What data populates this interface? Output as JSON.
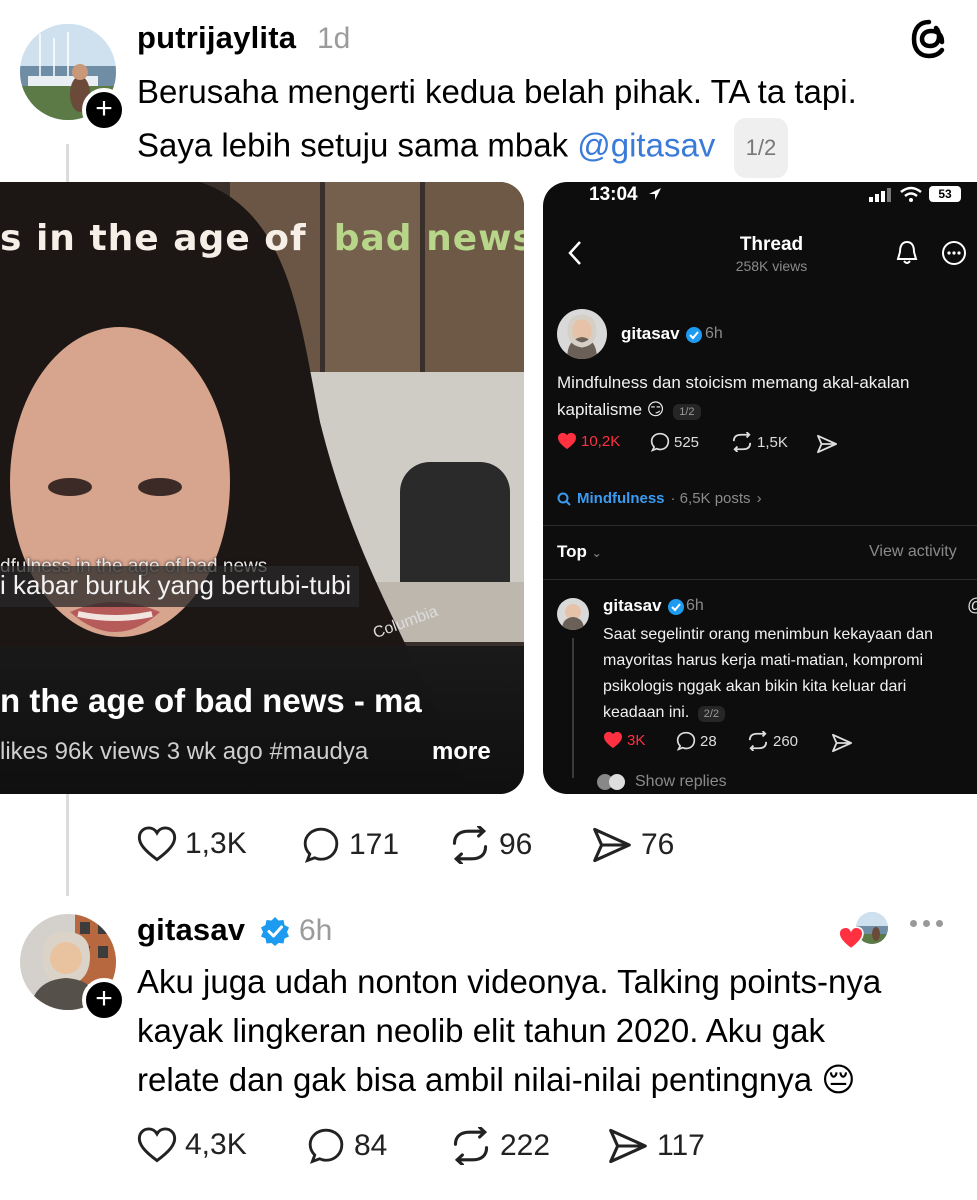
{
  "post1": {
    "username": "putrijaylita",
    "time": "1d",
    "text_line1": "Berusaha mengerti kedua belah pihak. TA ta tapi.",
    "text_line2_prefix": "Saya lebih setuju sama mbak ",
    "mention": "@gitasav",
    "page_pill": "1/2",
    "likes": "1,3K",
    "replies": "171",
    "reposts": "96",
    "shares": "76"
  },
  "video": {
    "top_title_a": "s  in the age of",
    "top_title_b": "bad news",
    "subtitle_small": "dfulness in the age of bad news",
    "subtitle_big": "i kabar buruk yang bertubi-tubi",
    "shirt_brand": "Columbia",
    "bottom_title": "n the age of bad news - ma",
    "meta": "likes  96k views  3 wk ago  #maudya",
    "more": "more"
  },
  "phone": {
    "status_time": "13:04",
    "battery": "53",
    "header_title": "Thread",
    "header_views": "258K views",
    "op_username": "gitasav",
    "op_time": "6h",
    "op_text_line1": "Mindfulness dan stoicism memang akal-akalan",
    "op_text_line2": "kapitalisme",
    "op_pill": "1/2",
    "op_likes": "10,2K",
    "op_replies": "525",
    "op_reposts": "1,5K",
    "topic": "Mindfulness",
    "topic_posts": "· 6,5K posts",
    "sort_label": "Top",
    "view_activity": "View activity",
    "reply_username": "gitasav",
    "reply_time": "6h",
    "reply_lines": [
      "Saat segelintir orang menimbun kekayaan dan",
      "mayoritas harus kerja mati-matian, kompromi",
      "psikologis nggak akan bikin kita keluar dari",
      "keadaan ini."
    ],
    "reply_pill": "2/2",
    "reply_likes": "3K",
    "reply_replies": "28",
    "reply_reposts": "260",
    "show_replies": "Show replies"
  },
  "post2": {
    "username": "gitasav",
    "time": "6h",
    "text_lines": [
      "Aku juga udah nonton videonya. Talking points-nya",
      "kayak lingkeran neolib elit tahun 2020. Aku gak",
      "relate dan gak bisa ambil nilai-nilai pentingnya"
    ],
    "emoji": "😔",
    "likes": "4,3K",
    "replies": "84",
    "reposts": "222",
    "shares": "117"
  },
  "colors": {
    "accent_link": "#3a7ad9",
    "like_red": "#ff3040",
    "verified_blue": "#1d9bf0",
    "video_green_text": "#b8d68a"
  }
}
